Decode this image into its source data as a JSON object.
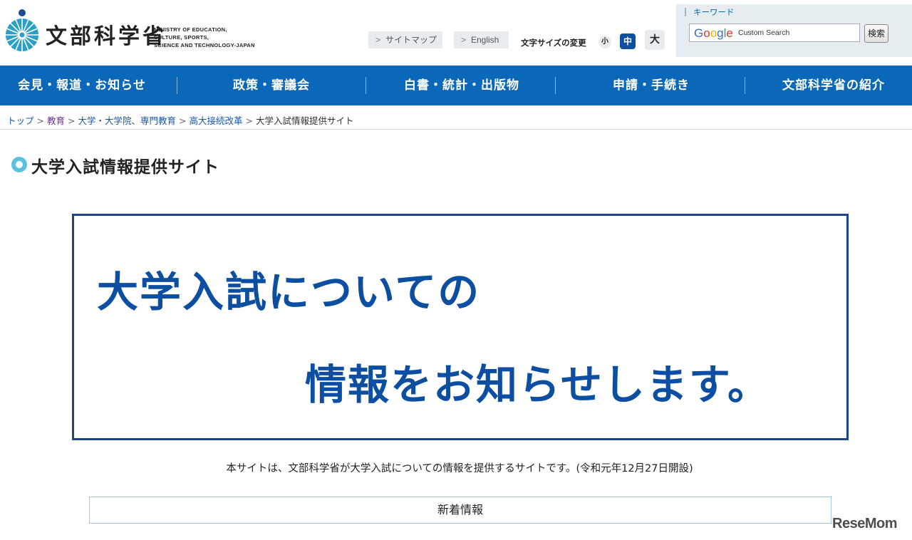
{
  "header": {
    "logo_ja": "文部科学省",
    "logo_en": [
      "MINISTRY OF EDUCATION,",
      "CULTURE, SPORTS,",
      "SCIENCE AND TECHNOLOGY-JAPAN"
    ],
    "sitemap": "サイトマップ",
    "english": "English",
    "fontsize_label": "文字サイズの変更",
    "fontsize_small": "小",
    "fontsize_mid": "中",
    "fontsize_large": "大"
  },
  "search": {
    "keyword_label": "キーワード",
    "google": "Google",
    "custom_search": "Custom Search",
    "button": "検索"
  },
  "nav": [
    "会見・報道・お知らせ",
    "政策・審議会",
    "白書・統計・出版物",
    "申請・手続き",
    "文部科学省の紹介"
  ],
  "breadcrumb": [
    "トップ",
    "教育",
    "大学・大学院、専門教育",
    "高大接続改革",
    "大学入試情報提供サイト"
  ],
  "page_title": "大学入試情報提供サイト",
  "banner": {
    "line1": "大学入試についての",
    "line2": "情報をお知らせします。"
  },
  "intro": "本サイトは、文部科学省が大学入試についての情報を提供するサイトです。(令和元年12月27日開設)",
  "news_heading": "新着情報",
  "watermark": "ReseMom",
  "colors": {
    "nav_bg": "#0b67b8",
    "banner_text": "#0b4ea2",
    "banner_border": "#1b4586",
    "title_icon": "#5bc1e0"
  }
}
